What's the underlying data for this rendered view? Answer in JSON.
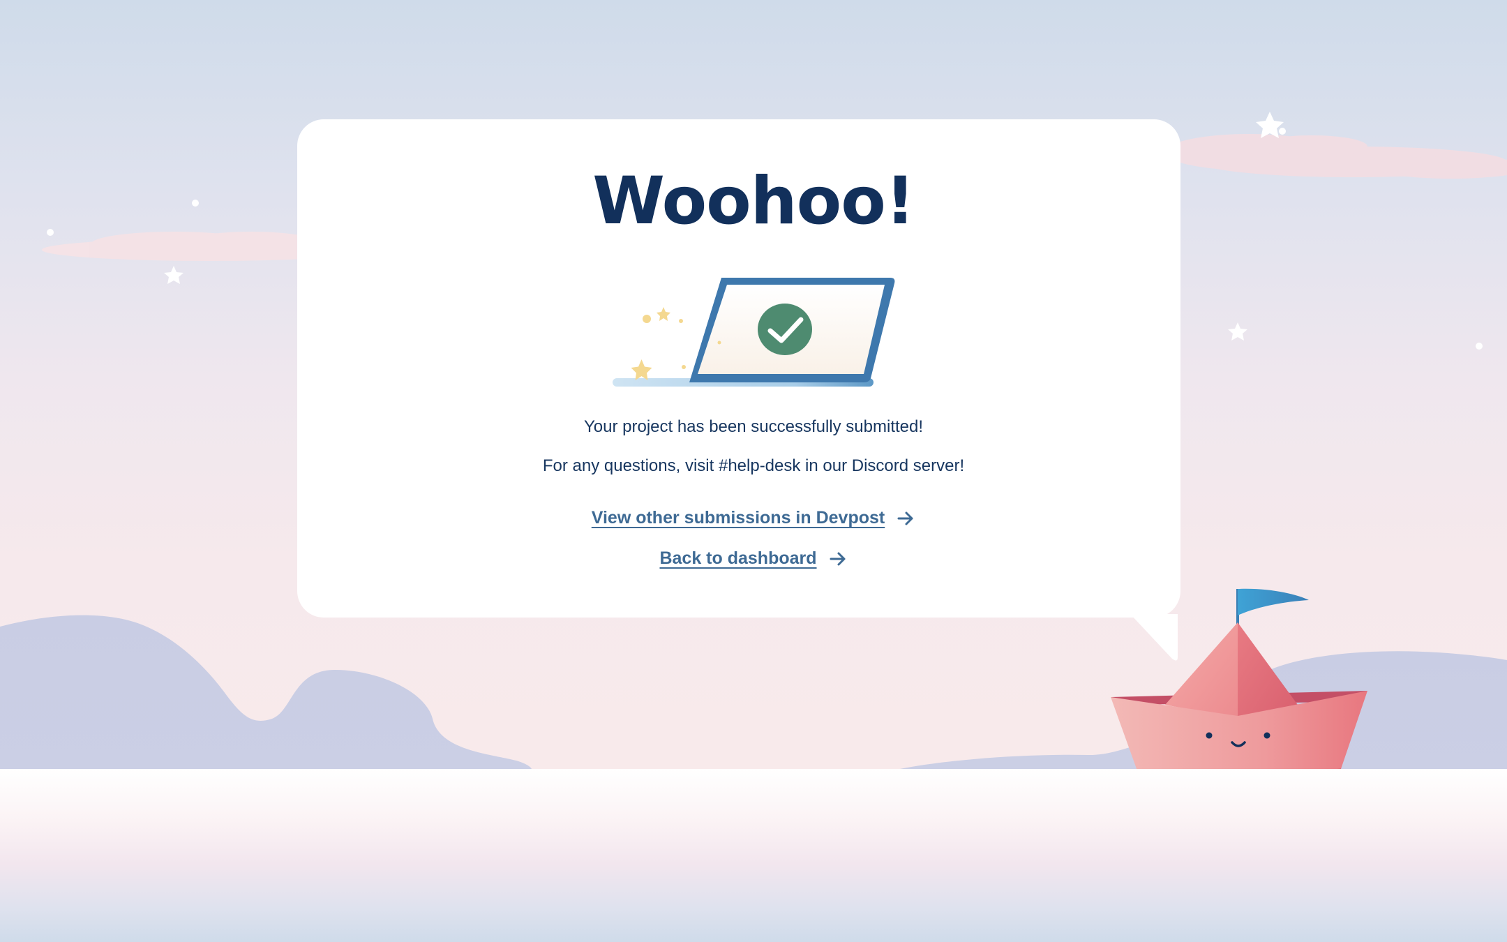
{
  "modal": {
    "title": "Woohoo!",
    "message": "Your project has been successfully submitted!",
    "help_text": "For any questions, visit #help-desk in our Discord server!"
  },
  "links": {
    "view_submissions": "View other submissions in Devpost",
    "back_dashboard": "Back to dashboard"
  },
  "icons": {
    "illustration": "laptop-check-icon",
    "link_arrow": "arrow-right-icon",
    "mascot": "paper-boat-icon"
  },
  "colors": {
    "title": "#12305b",
    "link": "#3e6a94",
    "success": "#4e8b70",
    "boat": "#ec8a8f",
    "flag": "#3e9dcd"
  }
}
